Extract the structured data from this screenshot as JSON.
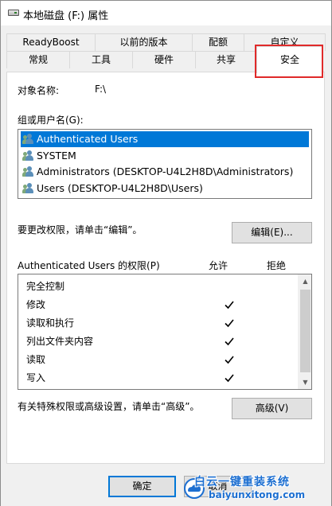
{
  "window": {
    "title": "本地磁盘 (F:) 属性"
  },
  "tabs": {
    "row1": [
      "ReadyBoost",
      "以前的版本",
      "配额",
      "自定义"
    ],
    "row2": [
      "常规",
      "工具",
      "硬件",
      "共享",
      "安全"
    ],
    "active": "安全"
  },
  "object": {
    "label": "对象名称:",
    "value": "F:\\"
  },
  "groups": {
    "label": "组或用户名(G):",
    "items": [
      "Authenticated Users",
      "SYSTEM",
      "Administrators (DESKTOP-U4L2H8D\\Administrators)",
      "Users (DESKTOP-U4L2H8D\\Users)"
    ],
    "selected_index": 0
  },
  "change_hint": "要更改权限，请单击“编辑”。",
  "edit_button": "编辑(E)...",
  "permissions": {
    "label": "Authenticated Users 的权限(P)",
    "allow_header": "允许",
    "deny_header": "拒绝",
    "rows": [
      {
        "name": "完全控制",
        "allow": false,
        "deny": false
      },
      {
        "name": "修改",
        "allow": true,
        "deny": false
      },
      {
        "name": "读取和执行",
        "allow": true,
        "deny": false
      },
      {
        "name": "列出文件夹内容",
        "allow": true,
        "deny": false
      },
      {
        "name": "读取",
        "allow": true,
        "deny": false
      },
      {
        "name": "写入",
        "allow": true,
        "deny": false
      }
    ]
  },
  "advanced_hint": "有关特殊权限或高级设置，请单击“高级”。",
  "advanced_button": "高级(V)",
  "footer": {
    "ok": "确定",
    "cancel": "取消"
  },
  "watermark": {
    "main": "白云一键重装系统",
    "url": "baiyunxitong.com"
  },
  "colors": {
    "selection": "#0078d7",
    "highlight_box": "#e02a2a",
    "watermark": "#1d6fd1"
  },
  "icons": {
    "title": "drive-icon",
    "user": "users-icon",
    "check": "check-icon"
  }
}
